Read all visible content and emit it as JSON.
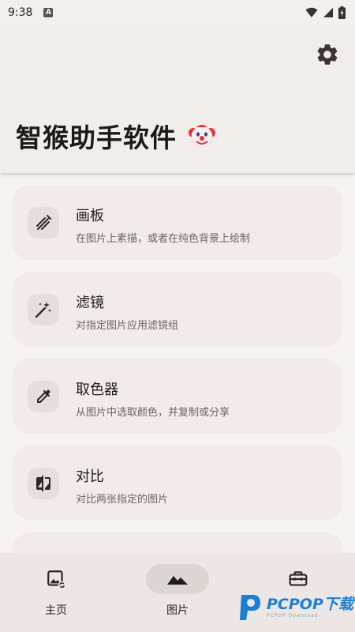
{
  "status_bar": {
    "time": "9:38",
    "notification_icon": "a-letter-icon",
    "icons": [
      "wifi-icon",
      "signal-icon",
      "battery-charging-icon"
    ]
  },
  "header": {
    "title": "智猴助手软件",
    "emoji": "🤡",
    "settings_icon": "gear-icon"
  },
  "tools": [
    {
      "title": "画板",
      "desc": "在图片上素描，或者在纯色背景上绘制",
      "icon": "draw-icon"
    },
    {
      "title": "滤镜",
      "desc": "对指定图片应用滤镜组",
      "icon": "magic-wand-icon"
    },
    {
      "title": "取色器",
      "desc": "从图片中选取颜色，并复制或分享",
      "icon": "eyedropper-icon"
    },
    {
      "title": "对比",
      "desc": "对比两张指定的图片",
      "icon": "compare-icon"
    }
  ],
  "bottom_nav": {
    "items": [
      {
        "label": "主页",
        "icon": "image-sync-icon",
        "active": false
      },
      {
        "label": "图片",
        "icon": "mountain-icon",
        "active": true
      },
      {
        "label": "",
        "icon": "toolbox-icon",
        "active": false
      }
    ]
  },
  "watermark": {
    "main": "PCPOP下载",
    "sub": "PCPOP Download"
  },
  "colors": {
    "background": "#f7f3f1",
    "card": "#f1ecea",
    "icon_box": "#e4dfdd",
    "active_pill": "#dcd6d3",
    "watermark": "#1a7fd6"
  }
}
